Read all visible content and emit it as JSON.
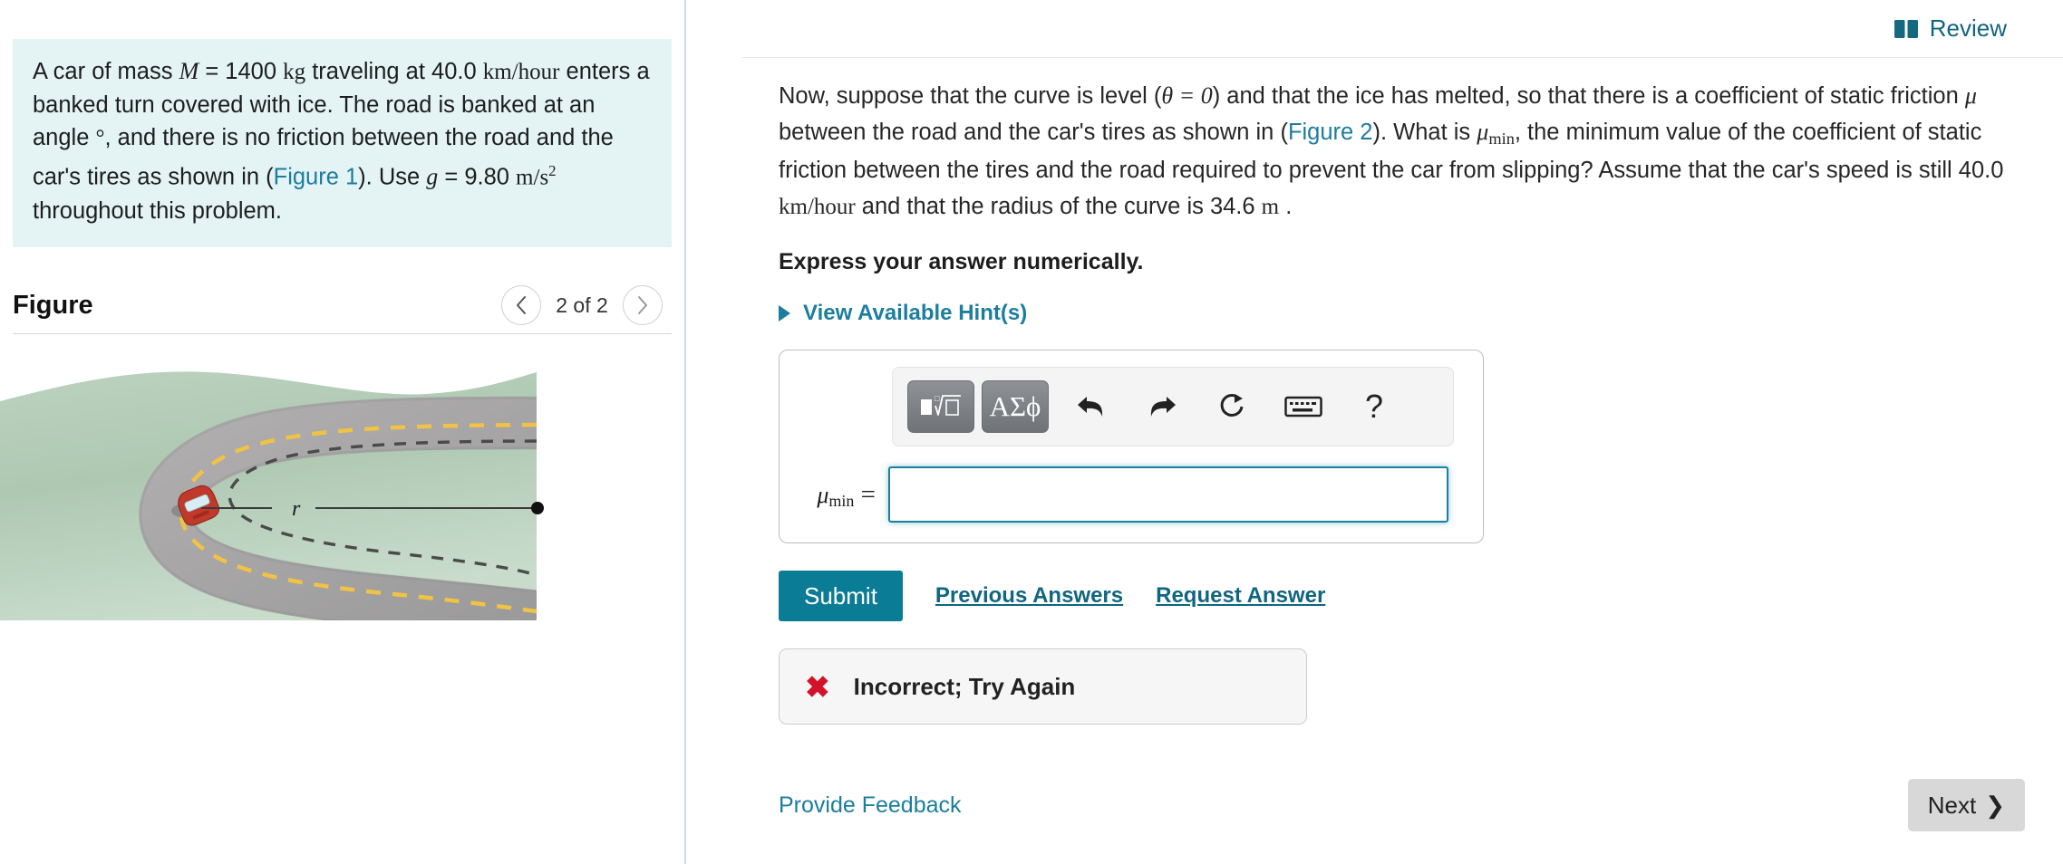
{
  "problem": {
    "text_parts": {
      "p1": "A car of mass ",
      "m_sym": "M",
      "p2": " = 1400 ",
      "kg": "kg",
      "p3": " traveling at 40.0 ",
      "kmh": "km/hour",
      "p4": " enters a banked turn covered with ice. The road is banked at an angle ",
      "deg": "°",
      "p5": ", and there is no friction between the road and the car's tires as shown in (",
      "figure1_link": "Figure 1",
      "p6": "). Use ",
      "g_sym": "g",
      "p7": " = 9.80 ",
      "ms2": "m/s",
      "p8": " throughout this problem."
    }
  },
  "figure": {
    "title": "Figure",
    "counter": "2 of 2",
    "prev_icon": "chevron-left-icon",
    "next_icon": "chevron-right-icon",
    "radius_label": "r",
    "colors": {
      "terrain": "#a9c5ad",
      "terrain_light": "#cfe0d2",
      "road": "#a9a8a8",
      "road_edge": "#7c7b7b",
      "center_line": "#f0c245",
      "trajectory": "#4a4a4a",
      "car_body": "#c0392b",
      "car_window": "#d8eef5",
      "radius_line": "#3a3a3a"
    }
  },
  "header": {
    "review_label": "Review",
    "review_icon": "open-book-icon"
  },
  "question": {
    "q1": "Now, suppose that the curve is level (",
    "theta_eq": "θ = 0",
    "q2": ") and that the ice has melted, so that there is a coefficient of static friction ",
    "mu_sym": "μ",
    "q3": " between the road and the car's tires as shown in (",
    "figure2_link": "Figure 2",
    "q4": "). What is ",
    "mu_min": "μ",
    "mu_min_sub": "min",
    "q5": ", the minimum value of the coefficient of static friction between the tires and the road required to prevent the car from slipping? Assume that the car's speed is still 40.0 ",
    "kmh": "km/hour",
    "q6": " and that the radius of the curve is 34.6 ",
    "m_unit": "m",
    "q7": " .",
    "express": "Express your answer numerically.",
    "hints_label": "View Available Hint(s)"
  },
  "answer": {
    "toolbar": {
      "template_button": "math-template-button",
      "greek_button_label": "ΑΣϕ",
      "undo_icon": "undo-arrow-icon",
      "redo_icon": "redo-arrow-icon",
      "reset_icon": "reset-circular-arrow-icon",
      "keyboard_icon": "keyboard-icon",
      "help_label": "?"
    },
    "label_mu": "μ",
    "label_sub": "min",
    "label_eq": " =",
    "input_value": "",
    "input_placeholder": ""
  },
  "actions": {
    "submit_label": "Submit",
    "previous_answers_label": "Previous Answers",
    "request_answer_label": "Request Answer"
  },
  "feedback": {
    "icon": "red-x-icon",
    "icon_glyph": "✖",
    "message": "Incorrect; Try Again"
  },
  "footer": {
    "provide_feedback_label": "Provide Feedback",
    "next_label": "Next",
    "next_icon": "chevron-right-icon",
    "next_glyph": "❯"
  },
  "colors": {
    "accent_teal": "#0b7c96",
    "link_teal": "#1b7e9e",
    "problem_bg": "#e4f4f5",
    "error_red": "#d3122a"
  }
}
